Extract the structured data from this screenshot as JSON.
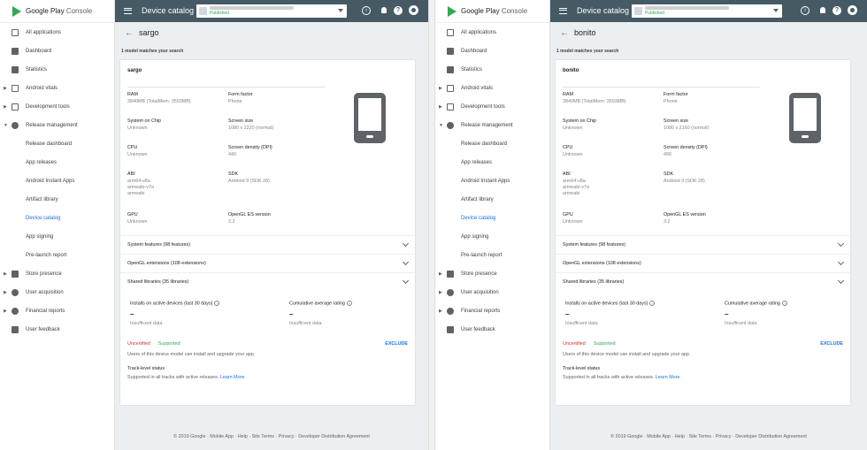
{
  "sidebar": {
    "logo_brand": "Google Play",
    "logo_suffix": "Console",
    "items": [
      {
        "label": "All applications",
        "caret": ""
      },
      {
        "label": "Dashboard",
        "caret": ""
      },
      {
        "label": "Statistics",
        "caret": ""
      },
      {
        "label": "Android vitals",
        "caret": "▶"
      },
      {
        "label": "Development tools",
        "caret": "▶"
      },
      {
        "label": "Release management",
        "caret": "▼"
      },
      {
        "label": "Release dashboard",
        "caret": ""
      },
      {
        "label": "App releases",
        "caret": ""
      },
      {
        "label": "Android Instant Apps",
        "caret": ""
      },
      {
        "label": "Artifact library",
        "caret": ""
      },
      {
        "label": "Device catalog",
        "caret": ""
      },
      {
        "label": "App signing",
        "caret": ""
      },
      {
        "label": "Pre-launch report",
        "caret": ""
      },
      {
        "label": "Store presence",
        "caret": "▶"
      },
      {
        "label": "User acquisition",
        "caret": "▶"
      },
      {
        "label": "Financial reports",
        "caret": "▶"
      },
      {
        "label": "User feedback",
        "caret": ""
      }
    ]
  },
  "topbar": {
    "title": "Device catalog",
    "app_status": "Published",
    "info_glyph": "i",
    "help_glyph": "?"
  },
  "common": {
    "matches": "1 model matches your search",
    "labels": {
      "ram": "RAM",
      "form_factor": "Form factor",
      "soc": "System on Chip",
      "screen_size": "Screen size",
      "cpu": "CPU",
      "density": "Screen density (DPI)",
      "abi": "ABI",
      "sdk": "SDK",
      "gpu": "GPU",
      "opengl": "OpenGL ES version"
    },
    "expanders": {
      "features": "System features (98 features)",
      "extensions": "OpenGL extensions (108 extensions)",
      "libraries": "Shared libraries (35 libraries)"
    },
    "installs_label": "Installs on active devices (last 30 days)",
    "rating_label": "Cumulative average rating",
    "dash": "–",
    "insufficient": "Insufficent data",
    "uncertified": "Uncertified",
    "supported": "Supported",
    "exclude": "EXCLUDE",
    "users_note": "Users of this device model can install and upgrade your app.",
    "track_title": "Track-level status",
    "track_desc": "Supported in all tracks with active releases.",
    "learn_more": "Learn More",
    "footer": "© 2019 Google · Mobile App · Help · Site Terms · Privacy · Developer Distribution Agreement"
  },
  "left": {
    "name": "sargo",
    "ram": "3840MB (TotalMem: 3593MB)",
    "form_factor": "Phone",
    "soc": "Unknown",
    "screen_size": "1080 x 2220 (normal)",
    "cpu": "Unknown",
    "density": "440",
    "abi1": "arm64-v8a",
    "abi2": "armeabi-v7a",
    "abi3": "armeabi",
    "sdk": "Android 9 (SDK 28)",
    "gpu": "Unknown",
    "opengl": "3.2"
  },
  "right": {
    "name": "bonito",
    "ram": "3840MB (TotalMem: 3593MB)",
    "form_factor": "Phone",
    "soc": "Unknown",
    "screen_size": "1080 x 2160 (normal)",
    "cpu": "Unknown",
    "density": "490",
    "abi1": "arm64-v8a",
    "abi2": "armeabi-v7a",
    "abi3": "armeabi",
    "sdk": "Android 9 (SDK 28)",
    "gpu": "Unknown",
    "opengl": "3.2"
  }
}
